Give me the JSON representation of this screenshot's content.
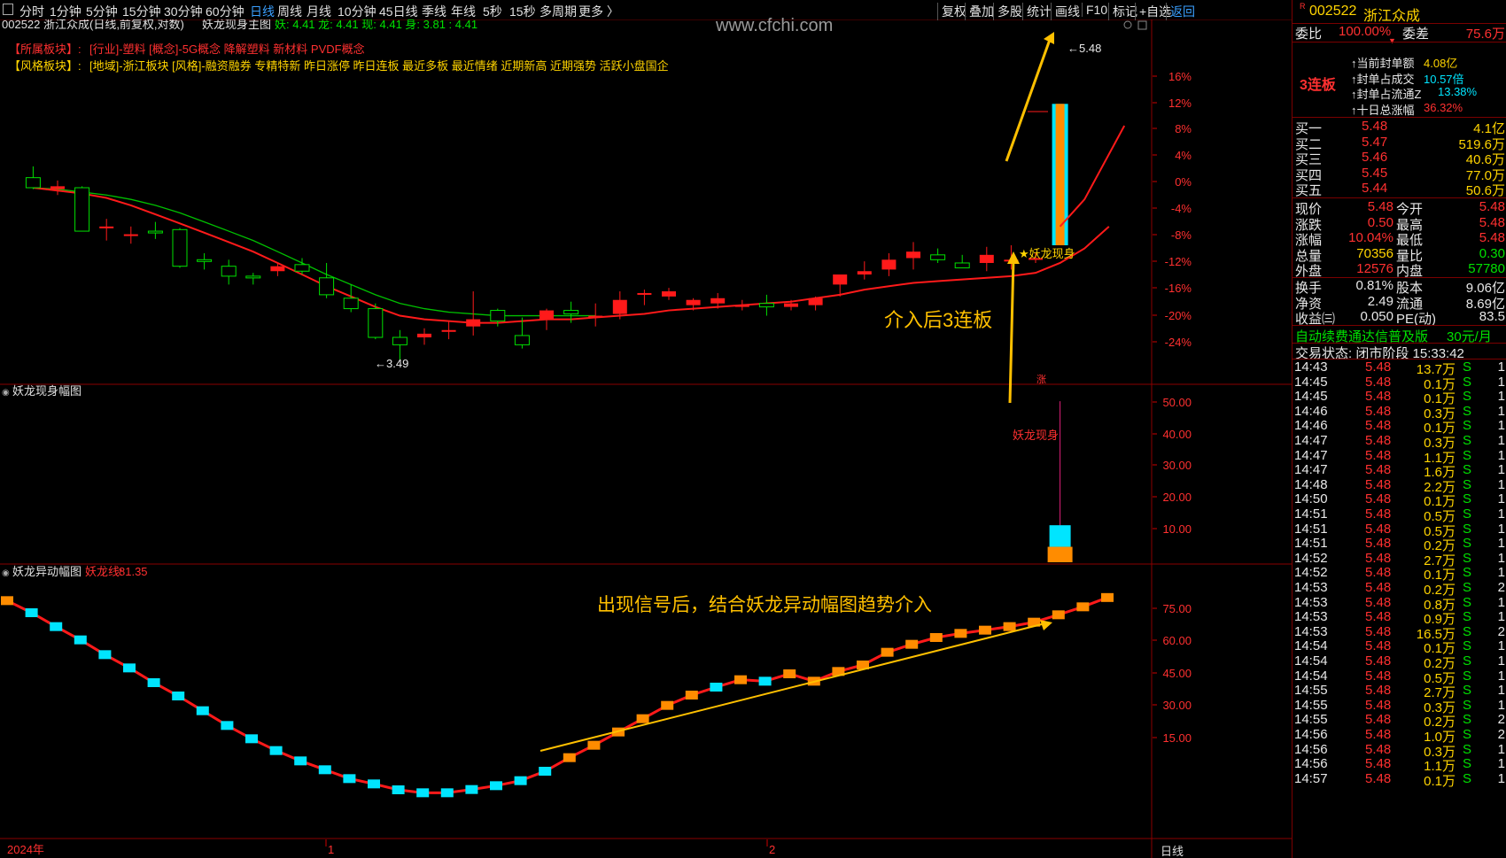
{
  "topbar": {
    "periods": [
      "分时",
      "1分钟",
      "5分钟",
      "15分钟",
      "30分钟",
      "60分钟",
      "日线",
      "周线",
      "月线",
      "10分钟",
      "45日线",
      "季线",
      "年线",
      "5秒",
      "15秒",
      "多周期",
      "更多 〉"
    ],
    "active_period": "日线",
    "right_buttons": [
      "复权",
      "叠加",
      "多股",
      "统计",
      "画线",
      "F10",
      "标记",
      "+自选",
      "返回"
    ]
  },
  "chart_header": {
    "stock": "002522 浙江众成(日线,前复权,对数)",
    "indicator": "妖龙现身主图",
    "indicator_values": "妖: 4.41  龙: 4.41  现: 4.41  身: 3.81 : 4.41"
  },
  "watermark": "www.cfchi.com",
  "sector_lines": {
    "label1": "【所属板块】:",
    "text1": "[行业]-塑料 [概念]-5G概念 降解塑料 新材料 PVDF概念",
    "label2": "【风格板块】:",
    "text2": "[地域]-浙江板块 [风格]-融资融券 专精特新 昨日涨停 昨日连板 最近多板 最近情绪 近期新高 近期强势 活跃小盘国企"
  },
  "price_labels": {
    "high": "5.48",
    "low": "3.49"
  },
  "main_annotations": {
    "signal_text": "妖龙现身",
    "callout": "介入后3连板",
    "lower_callout": "出现信号后，结合妖龙异动幅图趋势介入",
    "zhang": "涨"
  },
  "main_axis_labels": [
    "16%",
    "12%",
    "8%",
    "4%",
    "0%",
    "-4%",
    "-8%",
    "-12%",
    "-16%",
    "-20%",
    "-24%"
  ],
  "sub1": {
    "title": "妖龙现身幅图",
    "axis": [
      "50.00",
      "40.00",
      "30.00",
      "20.00",
      "10.00"
    ],
    "signal_text": "妖龙现身"
  },
  "sub2": {
    "title": "妖龙异动幅图",
    "line_name": "妖龙线:",
    "line_value": "81.35",
    "axis": [
      "75.00",
      "60.00",
      "45.00",
      "30.00",
      "15.00"
    ]
  },
  "bottom_axis": {
    "labels": [
      "2024年",
      "1",
      "2"
    ],
    "period_label": "日线"
  },
  "chart_data": [
    {
      "type": "candlestick",
      "title": "妖龙现身主图",
      "candles": [
        {
          "o": 4.4,
          "h": 4.48,
          "l": 4.32,
          "c": 4.33
        },
        {
          "o": 4.32,
          "h": 4.38,
          "l": 4.28,
          "c": 4.34
        },
        {
          "o": 4.33,
          "h": 4.34,
          "l": 4.04,
          "c": 4.04
        },
        {
          "o": 4.06,
          "h": 4.12,
          "l": 3.98,
          "c": 4.07
        },
        {
          "o": 4.01,
          "h": 4.07,
          "l": 3.96,
          "c": 4.02
        },
        {
          "o": 4.04,
          "h": 4.1,
          "l": 3.99,
          "c": 4.03
        },
        {
          "o": 4.05,
          "h": 4.06,
          "l": 3.81,
          "c": 3.82
        },
        {
          "o": 3.86,
          "h": 3.9,
          "l": 3.8,
          "c": 3.85
        },
        {
          "o": 3.82,
          "h": 3.86,
          "l": 3.71,
          "c": 3.76
        },
        {
          "o": 3.76,
          "h": 3.78,
          "l": 3.71,
          "c": 3.75
        },
        {
          "o": 3.79,
          "h": 3.84,
          "l": 3.76,
          "c": 3.82
        },
        {
          "o": 3.83,
          "h": 3.87,
          "l": 3.77,
          "c": 3.79
        },
        {
          "o": 3.75,
          "h": 3.84,
          "l": 3.63,
          "c": 3.65
        },
        {
          "o": 3.63,
          "h": 3.71,
          "l": 3.55,
          "c": 3.57
        },
        {
          "o": 3.57,
          "h": 3.6,
          "l": 3.4,
          "c": 3.41
        },
        {
          "o": 3.41,
          "h": 3.45,
          "l": 3.29,
          "c": 3.37
        },
        {
          "o": 3.41,
          "h": 3.46,
          "l": 3.37,
          "c": 3.43
        },
        {
          "o": 3.45,
          "h": 3.5,
          "l": 3.4,
          "c": 3.45
        },
        {
          "o": 3.47,
          "h": 3.67,
          "l": 3.42,
          "c": 3.51
        },
        {
          "o": 3.56,
          "h": 3.57,
          "l": 3.47,
          "c": 3.5
        },
        {
          "o": 3.42,
          "h": 3.52,
          "l": 3.35,
          "c": 3.37
        },
        {
          "o": 3.51,
          "h": 3.57,
          "l": 3.45,
          "c": 3.56
        },
        {
          "o": 3.56,
          "h": 3.61,
          "l": 3.49,
          "c": 3.54
        },
        {
          "o": 3.53,
          "h": 3.6,
          "l": 3.47,
          "c": 3.53
        },
        {
          "o": 3.54,
          "h": 3.67,
          "l": 3.51,
          "c": 3.62
        },
        {
          "o": 3.65,
          "h": 3.68,
          "l": 3.59,
          "c": 3.66
        },
        {
          "o": 3.64,
          "h": 3.69,
          "l": 3.62,
          "c": 3.67
        },
        {
          "o": 3.59,
          "h": 3.63,
          "l": 3.56,
          "c": 3.62
        },
        {
          "o": 3.6,
          "h": 3.66,
          "l": 3.57,
          "c": 3.63
        },
        {
          "o": 3.58,
          "h": 3.62,
          "l": 3.56,
          "c": 3.59
        },
        {
          "o": 3.6,
          "h": 3.65,
          "l": 3.53,
          "c": 3.58
        },
        {
          "o": 3.58,
          "h": 3.62,
          "l": 3.56,
          "c": 3.6
        },
        {
          "o": 3.59,
          "h": 3.64,
          "l": 3.56,
          "c": 3.63
        },
        {
          "o": 3.71,
          "h": 3.74,
          "l": 3.64,
          "c": 3.77
        },
        {
          "o": 3.77,
          "h": 3.85,
          "l": 3.74,
          "c": 3.79
        },
        {
          "o": 3.8,
          "h": 3.9,
          "l": 3.76,
          "c": 3.86
        },
        {
          "o": 3.87,
          "h": 3.97,
          "l": 3.8,
          "c": 3.91
        },
        {
          "o": 3.89,
          "h": 3.93,
          "l": 3.84,
          "c": 3.86
        },
        {
          "o": 3.84,
          "h": 3.89,
          "l": 3.81,
          "c": 3.81
        },
        {
          "o": 3.84,
          "h": 3.94,
          "l": 3.79,
          "c": 3.89
        },
        {
          "o": 3.86,
          "h": 3.95,
          "l": 3.8,
          "c": 3.86
        },
        {
          "o": 3.86,
          "h": 3.9,
          "l": 3.84,
          "c": 3.87
        },
        {
          "o": 3.95,
          "h": 4.95,
          "l": 3.95,
          "c": 4.95
        }
      ],
      "red_ma": [
        4.33,
        4.31,
        4.29,
        4.26,
        4.21,
        4.15,
        4.09,
        4.03,
        3.97,
        3.91,
        3.84,
        3.77,
        3.7,
        3.64,
        3.58,
        3.53,
        3.51,
        3.5,
        3.49,
        3.49,
        3.5,
        3.51,
        3.51,
        3.52,
        3.53,
        3.54,
        3.56,
        3.57,
        3.58,
        3.59,
        3.6,
        3.61,
        3.63,
        3.65,
        3.68,
        3.7,
        3.72,
        3.73,
        3.74,
        3.75,
        3.76,
        3.78,
        3.84,
        3.93,
        4.07
      ],
      "green_ma": [
        4.33,
        4.32,
        4.3,
        4.28,
        4.25,
        4.21,
        4.16,
        4.1,
        4.04,
        3.98,
        3.91,
        3.84,
        3.77,
        3.71,
        3.65,
        3.6,
        3.57,
        3.55,
        3.54,
        3.53,
        3.53,
        3.53,
        3.53,
        3.53
      ],
      "ylim": [
        3.2,
        5.6
      ]
    },
    {
      "type": "bar",
      "title": "妖龙现身幅图",
      "ylim": [
        0,
        55
      ],
      "signal_bar": {
        "index": 42,
        "cyan_value": 11.5,
        "orange_value": 4.8,
        "line_value": 50
      }
    },
    {
      "type": "line",
      "title": "妖龙异动幅图",
      "name": "妖龙线",
      "values": [
        80.3,
        76.2,
        71.5,
        67.0,
        62.0,
        57.5,
        52.5,
        48.0,
        43.0,
        38.0,
        33.5,
        29.5,
        26.0,
        23.0,
        20.0,
        18.2,
        16.2,
        15.2,
        15.2,
        16.3,
        17.6,
        19.3,
        22.5,
        27.1,
        31.3,
        35.8,
        40.3,
        44.8,
        48.3,
        51.0,
        53.5,
        53.0,
        55.5,
        53.0,
        56.3,
        58.5,
        62.8,
        65.5,
        67.8,
        69.2,
        70.3,
        71.5,
        73.0,
        75.5,
        78.2,
        81.35
      ],
      "colors": [
        "#ff8c00",
        "#00e5ff",
        "#00e5ff",
        "#00e5ff",
        "#00e5ff",
        "#00e5ff",
        "#00e5ff",
        "#00e5ff",
        "#00e5ff",
        "#00e5ff",
        "#00e5ff",
        "#00e5ff",
        "#00e5ff",
        "#00e5ff",
        "#00e5ff",
        "#00e5ff",
        "#00e5ff",
        "#00e5ff",
        "#00e5ff",
        "#00e5ff",
        "#00e5ff",
        "#00e5ff",
        "#00e5ff",
        "#ff8c00",
        "#ff8c00",
        "#ff8c00",
        "#ff8c00",
        "#ff8c00",
        "#ff8c00",
        "#00e5ff",
        "#ff8c00",
        "#00e5ff",
        "#ff8c00",
        "#ff8c00",
        "#ff8c00",
        "#ff8c00",
        "#ff8c00",
        "#ff8c00",
        "#ff8c00",
        "#ff8c00",
        "#ff8c00",
        "#ff8c00",
        "#ff8c00",
        "#ff8c00",
        "#ff8c00",
        "#ff8c00"
      ],
      "ylim": [
        0,
        90
      ]
    }
  ],
  "right_panel": {
    "code": "002522",
    "name": "浙江众成",
    "wb_label": "委比",
    "wb_value": "100.00%",
    "wc_label": "委差",
    "wc_value": "75.6万",
    "lianban": "3连板",
    "seal_items": [
      {
        "label": "当前封单额",
        "value": "4.08亿",
        "vcolor": "#ffd400"
      },
      {
        "label": "封单占成交",
        "value": "10.57倍",
        "vcolor": "#00e5ff"
      },
      {
        "label": "封单占流通Z",
        "value": "13.38%",
        "vcolor": "#00e5ff"
      },
      {
        "label": "十日总涨幅",
        "value": "36.32%",
        "vcolor": "#ff3030"
      }
    ],
    "buy_orders": [
      {
        "label": "买一",
        "price": "5.48",
        "vol": "4.1亿"
      },
      {
        "label": "买二",
        "price": "5.47",
        "vol": "519.6万"
      },
      {
        "label": "买三",
        "price": "5.46",
        "vol": "40.6万"
      },
      {
        "label": "买四",
        "price": "5.45",
        "vol": "77.0万"
      },
      {
        "label": "买五",
        "price": "5.44",
        "vol": "50.6万"
      }
    ],
    "quote_rows": [
      {
        "l1": "现价",
        "v1": "5.48",
        "c1": "#ff3030",
        "l2": "今开",
        "v2": "5.48",
        "c2": "#ff3030"
      },
      {
        "l1": "涨跌",
        "v1": "0.50",
        "c1": "#ff3030",
        "l2": "最高",
        "v2": "5.48",
        "c2": "#ff3030"
      },
      {
        "l1": "涨幅",
        "v1": "10.04%",
        "c1": "#ff3030",
        "l2": "最低",
        "v2": "5.48",
        "c2": "#ff3030"
      },
      {
        "l1": "总量",
        "v1": "70356",
        "c1": "#ffd400",
        "l2": "量比",
        "v2": "0.30",
        "c2": "#00e000"
      },
      {
        "l1": "外盘",
        "v1": "12576",
        "c1": "#ff3030",
        "l2": "内盘",
        "v2": "57780",
        "c2": "#00e000"
      }
    ],
    "stat_rows": [
      {
        "l1": "换手",
        "v1": "0.81%",
        "l2": "股本",
        "v2": "9.06亿"
      },
      {
        "l1": "净资",
        "v1": "2.49",
        "l2": "流通",
        "v2": "8.69亿"
      },
      {
        "l1": "收益㈢",
        "v1": "0.050",
        "l2": "PE(动)",
        "v2": "83.5"
      }
    ],
    "promo": "自动续费通达信普及版",
    "promo_price": "30元/月",
    "trade_status": "交易状态: 闭市阶段 15:33:42",
    "ticks": [
      {
        "t": "14:43",
        "p": "5.48",
        "v": "13.7万",
        "d": "S",
        "n": "1"
      },
      {
        "t": "14:45",
        "p": "5.48",
        "v": "0.1万",
        "d": "S",
        "n": "1"
      },
      {
        "t": "14:45",
        "p": "5.48",
        "v": "0.1万",
        "d": "S",
        "n": "1"
      },
      {
        "t": "14:46",
        "p": "5.48",
        "v": "0.3万",
        "d": "S",
        "n": "1"
      },
      {
        "t": "14:46",
        "p": "5.48",
        "v": "0.1万",
        "d": "S",
        "n": "1"
      },
      {
        "t": "14:47",
        "p": "5.48",
        "v": "0.3万",
        "d": "S",
        "n": "1"
      },
      {
        "t": "14:47",
        "p": "5.48",
        "v": "1.1万",
        "d": "S",
        "n": "1"
      },
      {
        "t": "14:47",
        "p": "5.48",
        "v": "1.6万",
        "d": "S",
        "n": "1"
      },
      {
        "t": "14:48",
        "p": "5.48",
        "v": "2.2万",
        "d": "S",
        "n": "1"
      },
      {
        "t": "14:50",
        "p": "5.48",
        "v": "0.1万",
        "d": "S",
        "n": "1"
      },
      {
        "t": "14:51",
        "p": "5.48",
        "v": "0.5万",
        "d": "S",
        "n": "1"
      },
      {
        "t": "14:51",
        "p": "5.48",
        "v": "0.5万",
        "d": "S",
        "n": "1"
      },
      {
        "t": "14:51",
        "p": "5.48",
        "v": "0.2万",
        "d": "S",
        "n": "1"
      },
      {
        "t": "14:52",
        "p": "5.48",
        "v": "2.7万",
        "d": "S",
        "n": "1"
      },
      {
        "t": "14:52",
        "p": "5.48",
        "v": "0.1万",
        "d": "S",
        "n": "1"
      },
      {
        "t": "14:53",
        "p": "5.48",
        "v": "0.2万",
        "d": "S",
        "n": "2"
      },
      {
        "t": "14:53",
        "p": "5.48",
        "v": "0.8万",
        "d": "S",
        "n": "1"
      },
      {
        "t": "14:53",
        "p": "5.48",
        "v": "0.9万",
        "d": "S",
        "n": "1"
      },
      {
        "t": "14:53",
        "p": "5.48",
        "v": "16.5万",
        "d": "S",
        "n": "2"
      },
      {
        "t": "14:54",
        "p": "5.48",
        "v": "0.1万",
        "d": "S",
        "n": "1"
      },
      {
        "t": "14:54",
        "p": "5.48",
        "v": "0.2万",
        "d": "S",
        "n": "1"
      },
      {
        "t": "14:54",
        "p": "5.48",
        "v": "0.5万",
        "d": "S",
        "n": "1"
      },
      {
        "t": "14:55",
        "p": "5.48",
        "v": "2.7万",
        "d": "S",
        "n": "1"
      },
      {
        "t": "14:55",
        "p": "5.48",
        "v": "0.3万",
        "d": "S",
        "n": "1"
      },
      {
        "t": "14:55",
        "p": "5.48",
        "v": "0.2万",
        "d": "S",
        "n": "2"
      },
      {
        "t": "14:56",
        "p": "5.48",
        "v": "1.0万",
        "d": "S",
        "n": "2"
      },
      {
        "t": "14:56",
        "p": "5.48",
        "v": "0.3万",
        "d": "S",
        "n": "1"
      },
      {
        "t": "14:56",
        "p": "5.48",
        "v": "1.1万",
        "d": "S",
        "n": "1"
      },
      {
        "t": "14:57",
        "p": "5.48",
        "v": "0.1万",
        "d": "S",
        "n": "1"
      }
    ]
  }
}
